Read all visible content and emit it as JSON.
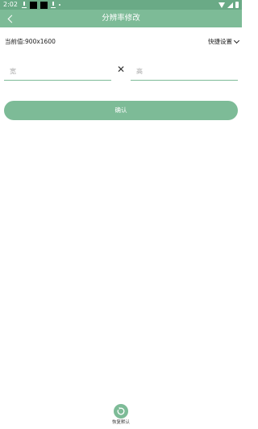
{
  "status_bar": {
    "time": "2:02"
  },
  "app_bar": {
    "title": "分辨率修改",
    "back_icon": "chevron-left-icon"
  },
  "current": {
    "label": "当前值:900x1600",
    "quick_settings": "快捷设置"
  },
  "inputs": {
    "width_placeholder": "宽",
    "height_placeholder": "高",
    "separator": "✕"
  },
  "confirm_label": "确认",
  "restore_label": "恢复默认",
  "colors": {
    "accent": "#7dbb97",
    "status_bar": "#6aaa86"
  }
}
